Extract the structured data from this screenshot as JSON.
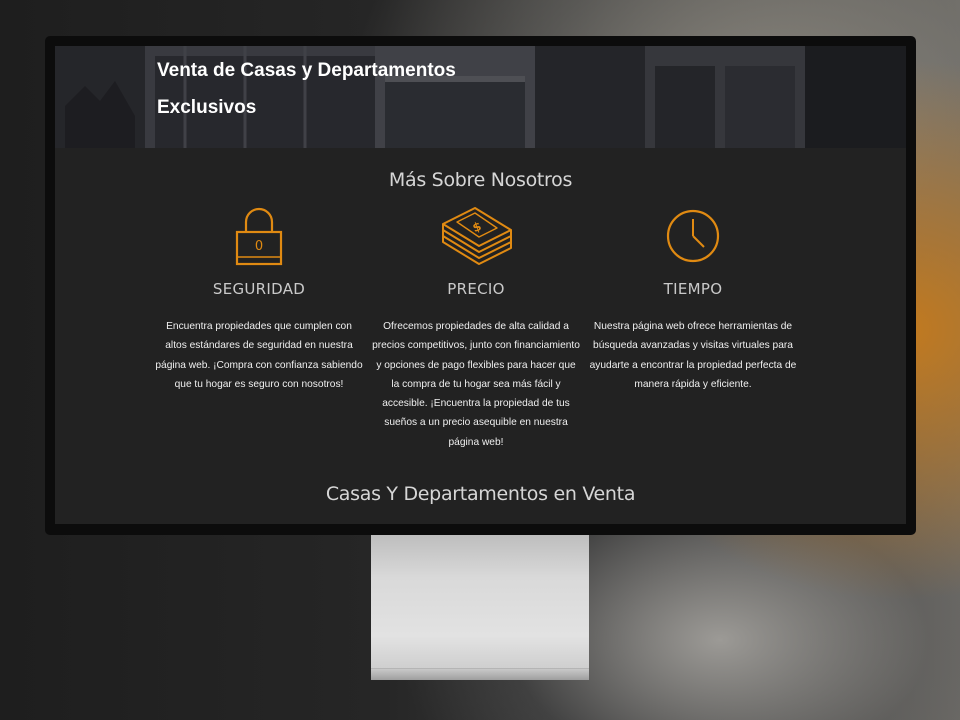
{
  "hero": {
    "title_line1": "Venta de Casas y Departamentos",
    "title_line2": "Exclusivos"
  },
  "about": {
    "title": "Más Sobre Nosotros",
    "features": [
      {
        "icon": "padlock-icon",
        "title": "SEGURIDAD",
        "text": "Encuentra propiedades que cumplen con altos estándares de seguridad en nuestra página web. ¡Compra con confianza sabiendo que tu hogar es seguro con nosotros!"
      },
      {
        "icon": "money-stack-icon",
        "title": "PRECIO",
        "text": "Ofrecemos propiedades de alta calidad a precios competitivos, junto con financiamiento y opciones de pago flexibles para hacer que la compra de tu hogar sea más fácil y accesible. ¡Encuentra la propiedad de tus sueños a un precio asequible en nuestra página web!"
      },
      {
        "icon": "clock-icon",
        "title": "TIEMPO",
        "text": "Nuestra página web ofrece herramientas de búsqueda avanzadas y visitas virtuales para ayudarte a encontrar la propiedad perfecta de manera rápida y eficiente."
      }
    ]
  },
  "listings": {
    "title": "Casas Y Departamentos en Venta"
  },
  "colors": {
    "accent": "#e08a12",
    "screen_bg": "#222222",
    "text": "#f0f0f0"
  }
}
